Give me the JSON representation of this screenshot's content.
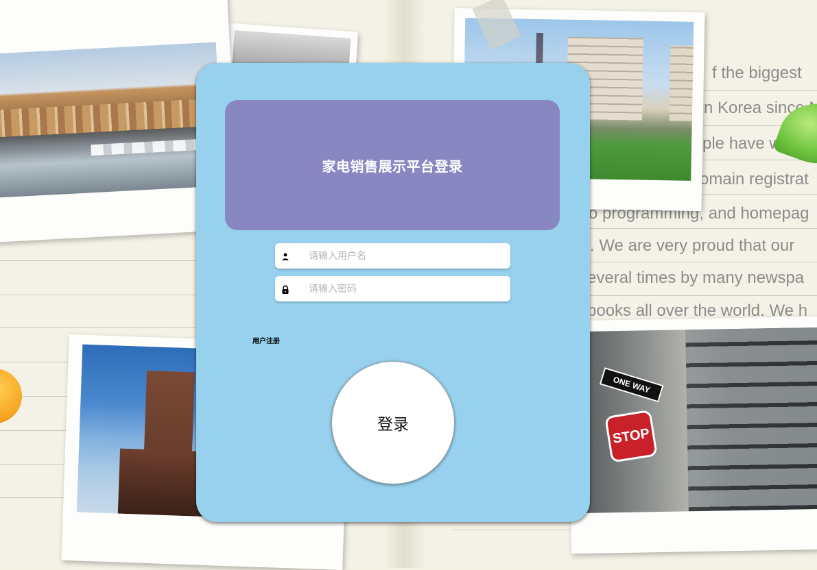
{
  "page": {
    "title": "家电销售展示平台登录"
  },
  "login_form": {
    "username_placeholder": "请输入用户名",
    "password_placeholder": "请输入密码",
    "username_icon": "user-icon",
    "password_icon": "lock-icon",
    "register_link": "用户注册",
    "login_button": "登录"
  },
  "background": {
    "notebook_text": [
      "f the biggest",
      "n Korea since N",
      "ple have w",
      "omain registrat",
      "o programming, and homepag",
      ". We are very proud that  our",
      "everal times by many newspa",
      "books all over the world. We h"
    ],
    "sign_texts": {
      "stop": "STOP",
      "one_way": "ONE WAY"
    }
  },
  "colors": {
    "panel_background": "#97d1ed",
    "title_box": "#8987c2",
    "title_text": "#ffffff",
    "button_background": "#ffffff"
  }
}
